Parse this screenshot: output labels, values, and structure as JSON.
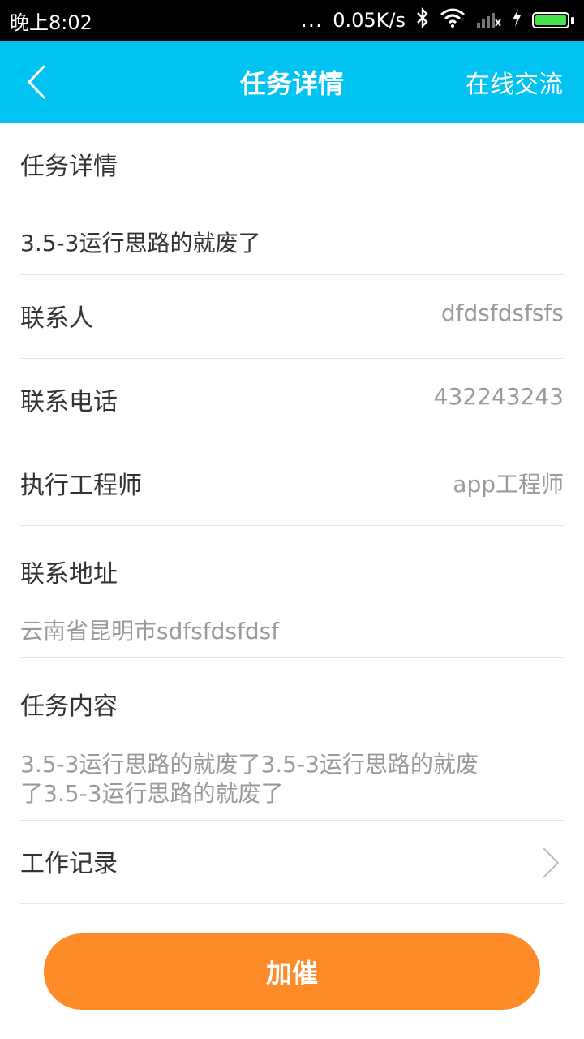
{
  "status_bar": {
    "time": "晚上8:02",
    "dots": "...",
    "network_speed": "0.05K/s",
    "icons": [
      "bluetooth-icon",
      "wifi-icon",
      "signal-icon",
      "charging-icon",
      "battery-icon"
    ],
    "battery_color": "#45e24a"
  },
  "nav": {
    "title": "任务详情",
    "action": "在线交流",
    "background": "#00c3f2"
  },
  "task": {
    "section_label": "任务详情",
    "name": "3.5-3运行思路的就废了",
    "contact_label": "联系人",
    "contact_value": "dfdsfdsfsfs",
    "phone_label": "联系电话",
    "phone_value": "432243243",
    "engineer_label": "执行工程师",
    "engineer_value": "app工程师",
    "address_label": "联系地址",
    "address_value": "云南省昆明市sdfsfdsfdsf",
    "content_label": "任务内容",
    "content_line1": "3.5-3运行思路的就废了3.5-3运行思路的就废",
    "content_line2": "了3.5-3运行思路的就废了",
    "worklog_label": "工作记录"
  },
  "cta": {
    "label": "加催",
    "color": "#ff8a28"
  }
}
